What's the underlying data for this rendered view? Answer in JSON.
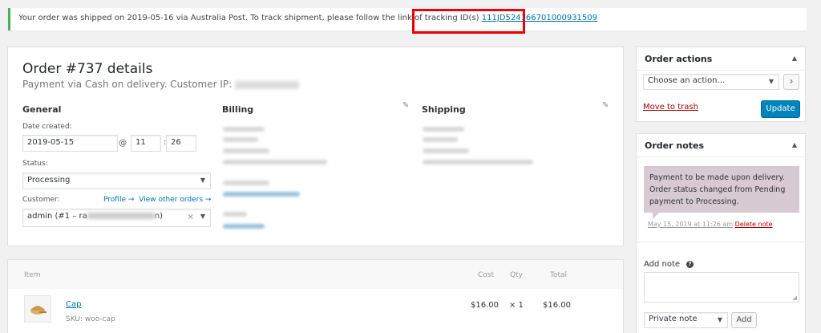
{
  "notice": {
    "text": "Your order was shipped on 2019-05-16 via Australia Post. To track shipment, please follow the link of tracking ID(s)",
    "tracking_id": "111JD524166701000931509"
  },
  "order": {
    "title": "Order #737 details",
    "subtitle": "Payment via Cash on delivery. Customer IP:",
    "general": {
      "heading": "General",
      "date_label": "Date created:",
      "date_value": "2019-05-15",
      "at": "@",
      "hour": "11",
      "colon": ":",
      "minute": "26",
      "status_label": "Status:",
      "status_value": "Processing",
      "customer_label": "Customer:",
      "profile_link": "Profile →",
      "other_orders_link": "View other orders →",
      "customer_value": "admin (#1 – ra",
      "customer_suffix": "n)",
      "clear": "×"
    },
    "billing": {
      "heading": "Billing"
    },
    "shipping": {
      "heading": "Shipping"
    }
  },
  "items": {
    "headers": {
      "item": "Item",
      "cost": "Cost",
      "qty": "Qty",
      "total": "Total"
    },
    "rows": [
      {
        "name": "Cap",
        "sku": "SKU: woo-cap",
        "cost": "$16.00",
        "qty": "× 1",
        "total": "$16.00"
      }
    ]
  },
  "order_actions": {
    "title": "Order actions",
    "select_value": "Choose an action...",
    "go": "›",
    "trash": "Move to trash",
    "update": "Update"
  },
  "order_notes": {
    "title": "Order notes",
    "note_text": "Payment to be made upon delivery. Order status changed from Pending payment to Processing.",
    "note_date": "May 15, 2019 at 11:26 am",
    "delete": "Delete note",
    "add_label": "Add note",
    "help": "?",
    "note_type": "Private note",
    "add_button": "Add"
  }
}
